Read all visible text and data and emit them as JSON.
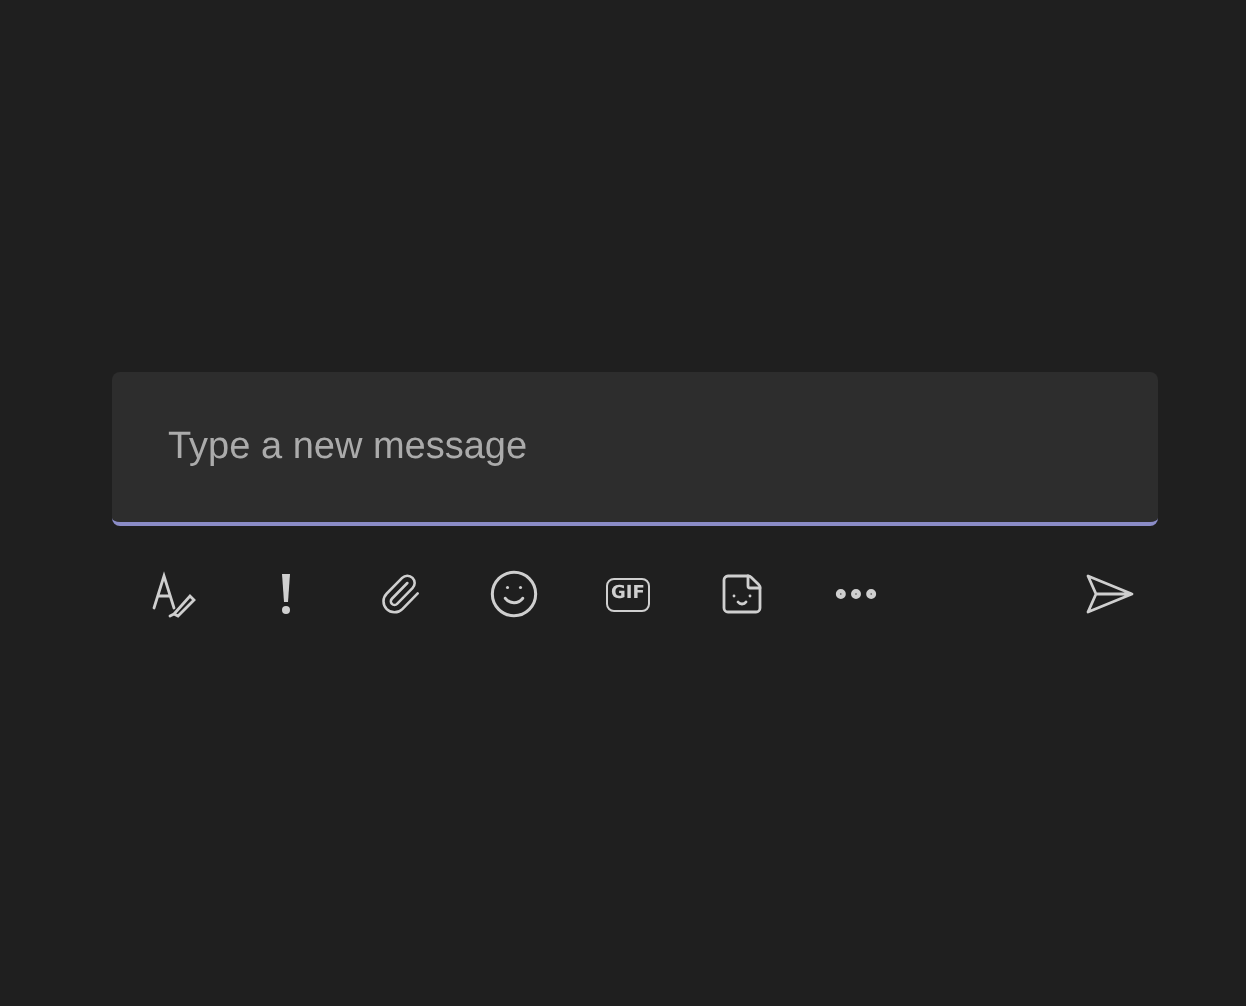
{
  "compose": {
    "placeholder": "Type a new message"
  },
  "toolbar": {
    "gif_label": "GIF"
  }
}
